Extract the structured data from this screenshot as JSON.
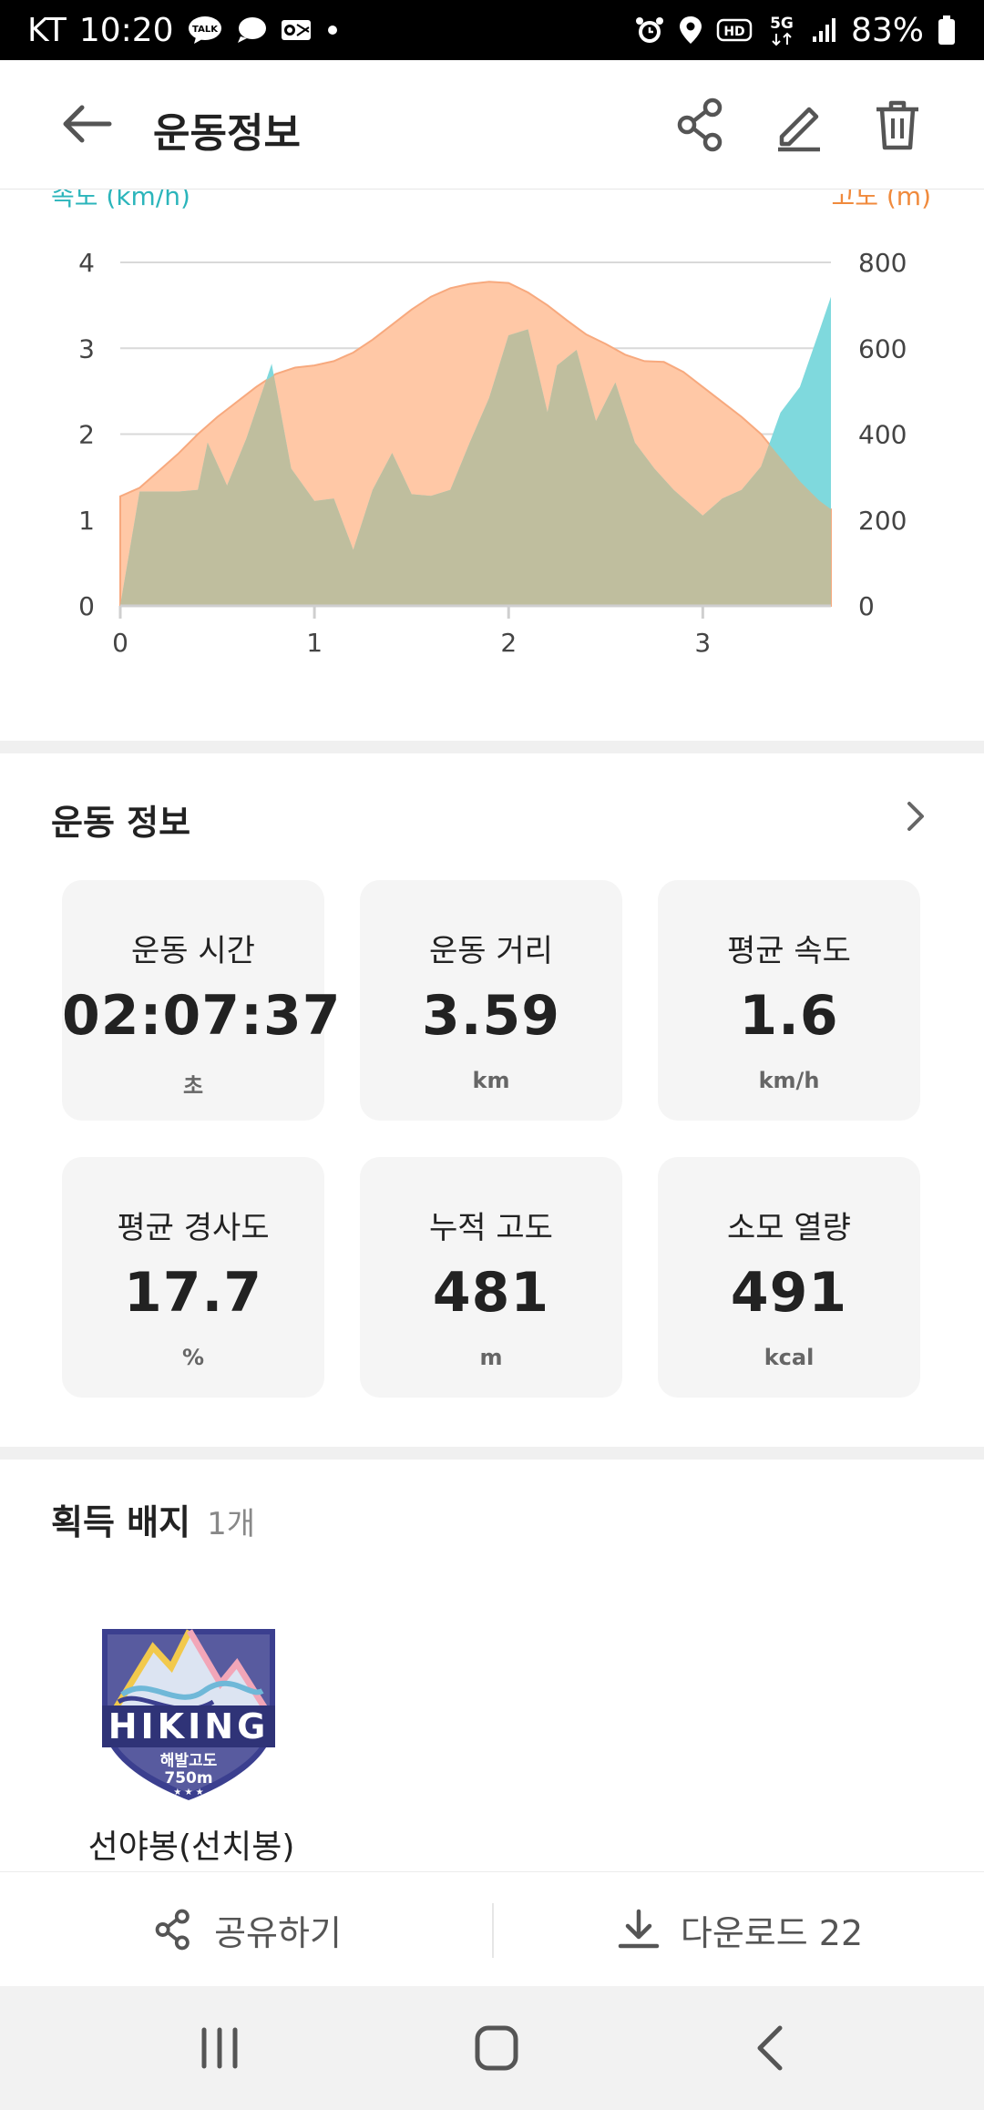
{
  "status_bar": {
    "carrier": "KT",
    "time": "10:20",
    "battery": "83%"
  },
  "header": {
    "title": "운동정보"
  },
  "chart_data": {
    "type": "area",
    "title": "",
    "xlabel": "",
    "ylabel_left": "속도 (km/h)",
    "ylabel_right": "고도 (m)",
    "x_ticks": [
      "0",
      "1",
      "2",
      "3"
    ],
    "y_left_ticks": [
      "0",
      "1",
      "2",
      "3",
      "4"
    ],
    "y_right_ticks": [
      "0",
      "200",
      "400",
      "600",
      "800"
    ],
    "xlim": [
      0,
      3.66
    ],
    "y_left_lim": [
      0,
      4
    ],
    "y_right_lim": [
      0,
      800
    ],
    "grid": true,
    "colors": {
      "altitude": "#FFC8A6",
      "speed": "#7FD9DD",
      "overlap": "#BFBE9E",
      "left_axis": "#2BB5BB",
      "right_axis": "#F08A3C"
    },
    "series": [
      {
        "name": "고도",
        "axis": "right",
        "x": [
          0,
          0.1,
          0.2,
          0.3,
          0.4,
          0.5,
          0.6,
          0.7,
          0.8,
          0.9,
          1.0,
          1.1,
          1.2,
          1.3,
          1.4,
          1.5,
          1.6,
          1.7,
          1.8,
          1.9,
          2.0,
          2.1,
          2.2,
          2.3,
          2.4,
          2.5,
          2.6,
          2.7,
          2.8,
          2.9,
          3.0,
          3.1,
          3.2,
          3.3,
          3.4,
          3.5,
          3.6,
          3.66
        ],
        "values": [
          255,
          275,
          315,
          355,
          400,
          440,
          475,
          510,
          540,
          555,
          560,
          570,
          590,
          620,
          655,
          690,
          720,
          740,
          750,
          755,
          752,
          730,
          700,
          665,
          632,
          610,
          585,
          570,
          568,
          545,
          510,
          475,
          440,
          400,
          345,
          290,
          245,
          225
        ]
      },
      {
        "name": "속도",
        "axis": "left",
        "x": [
          0,
          0.1,
          0.2,
          0.3,
          0.4,
          0.45,
          0.55,
          0.65,
          0.78,
          0.88,
          1.0,
          1.1,
          1.2,
          1.3,
          1.4,
          1.5,
          1.6,
          1.7,
          1.8,
          1.9,
          2.0,
          2.1,
          2.2,
          2.25,
          2.35,
          2.45,
          2.55,
          2.65,
          2.75,
          2.85,
          3.0,
          3.1,
          3.2,
          3.3,
          3.4,
          3.5,
          3.6,
          3.66
        ],
        "values": [
          0,
          1.33,
          1.33,
          1.33,
          1.35,
          1.9,
          1.4,
          1.95,
          2.82,
          1.6,
          1.22,
          1.25,
          0.65,
          1.35,
          1.78,
          1.3,
          1.28,
          1.35,
          1.9,
          2.42,
          3.15,
          3.22,
          2.25,
          2.8,
          2.98,
          2.15,
          2.6,
          1.9,
          1.6,
          1.35,
          1.05,
          1.25,
          1.35,
          1.62,
          2.25,
          2.55,
          3.2,
          3.6
        ]
      }
    ]
  },
  "workout": {
    "section_title": "운동 정보",
    "stats": [
      {
        "label": "운동 시간",
        "value": "02:07:37",
        "unit": "초"
      },
      {
        "label": "운동 거리",
        "value": "3.59",
        "unit": "km"
      },
      {
        "label": "평균 속도",
        "value": "1.6",
        "unit": "km/h"
      },
      {
        "label": "평균 경사도",
        "value": "17.7",
        "unit": "%"
      },
      {
        "label": "누적 고도",
        "value": "481",
        "unit": "m"
      },
      {
        "label": "소모 열량",
        "value": "491",
        "unit": "kcal"
      }
    ]
  },
  "badges": {
    "section_title": "획득 배지",
    "count": "1개",
    "items": [
      {
        "name": "선야봉(선치봉)",
        "emblem_title": "HIKING",
        "emblem_sub": "해발고도",
        "emblem_alt": "750m"
      }
    ]
  },
  "bottom_bar": {
    "share_label": "공유하기",
    "download_label": "다운로드 22"
  },
  "icons": {
    "back": "arrow-left-icon",
    "share": "share-icon",
    "edit": "pencil-icon",
    "delete": "trash-icon",
    "chevron": "chevron-right-icon",
    "download": "download-icon"
  }
}
